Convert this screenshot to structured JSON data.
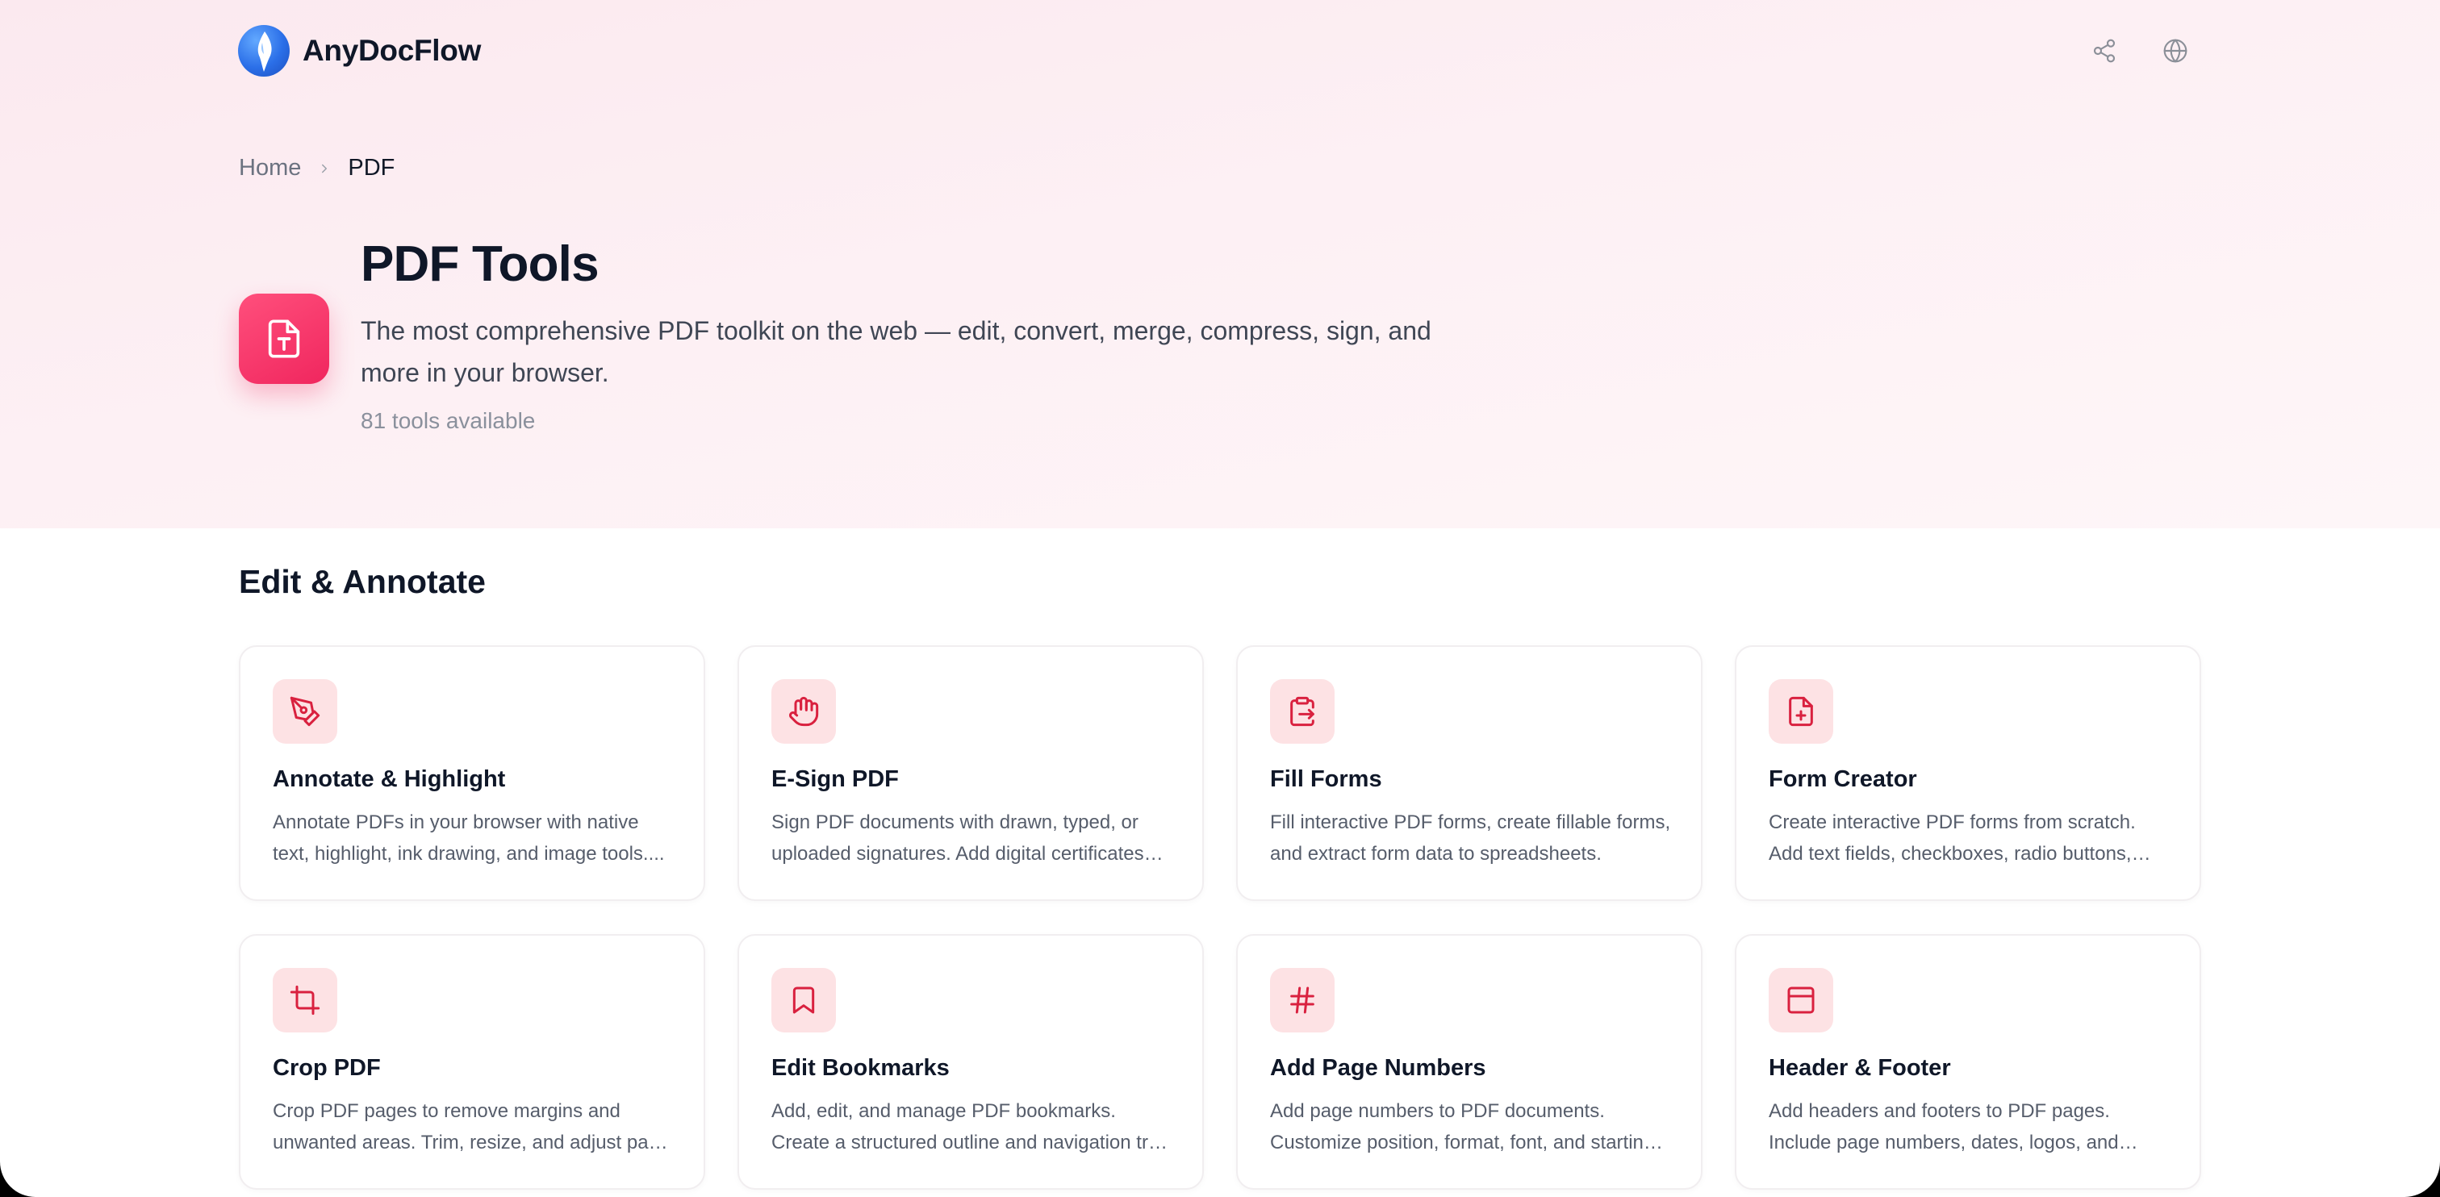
{
  "brand": {
    "name": "AnyDocFlow"
  },
  "header": {
    "share_icon": "share-icon",
    "language_icon": "globe-icon"
  },
  "breadcrumb": {
    "home": "Home",
    "current": "PDF"
  },
  "category": {
    "icon": "file-text-icon",
    "title": "PDF Tools",
    "description": "The most comprehensive PDF toolkit on the web — edit, convert, merge, compress, sign, and more in your browser.",
    "count_label": "81 tools available"
  },
  "section": {
    "title": "Edit & Annotate"
  },
  "cards": [
    {
      "icon": "pen-tool-icon",
      "title": "Annotate & Highlight",
      "description": "Annotate PDFs in your browser with native text, highlight, ink drawing, and image tools...."
    },
    {
      "icon": "hand-icon",
      "title": "E-Sign PDF",
      "description": "Sign PDF documents with drawn, typed, or uploaded signatures. Add digital certificates…"
    },
    {
      "icon": "clipboard-arrow-icon",
      "title": "Fill Forms",
      "description": "Fill interactive PDF forms, create fillable forms, and extract form data to spreadsheets."
    },
    {
      "icon": "file-plus-icon",
      "title": "Form Creator",
      "description": "Create interactive PDF forms from scratch. Add text fields, checkboxes, radio buttons,…"
    },
    {
      "icon": "crop-icon",
      "title": "Crop PDF",
      "description": "Crop PDF pages to remove margins and unwanted areas. Trim, resize, and adjust pa…"
    },
    {
      "icon": "bookmark-icon",
      "title": "Edit Bookmarks",
      "description": "Add, edit, and manage PDF bookmarks. Create a structured outline and navigation tr…"
    },
    {
      "icon": "hash-icon",
      "title": "Add Page Numbers",
      "description": "Add page numbers to PDF documents. Customize position, format, font, and startin…"
    },
    {
      "icon": "panel-top-icon",
      "title": "Header & Footer",
      "description": "Add headers and footers to PDF pages. Include page numbers, dates, logos, and…"
    }
  ],
  "colors": {
    "accent": "#f0265e",
    "icon_tint": "#d9213f",
    "icon_bg": "#fde2e4"
  }
}
